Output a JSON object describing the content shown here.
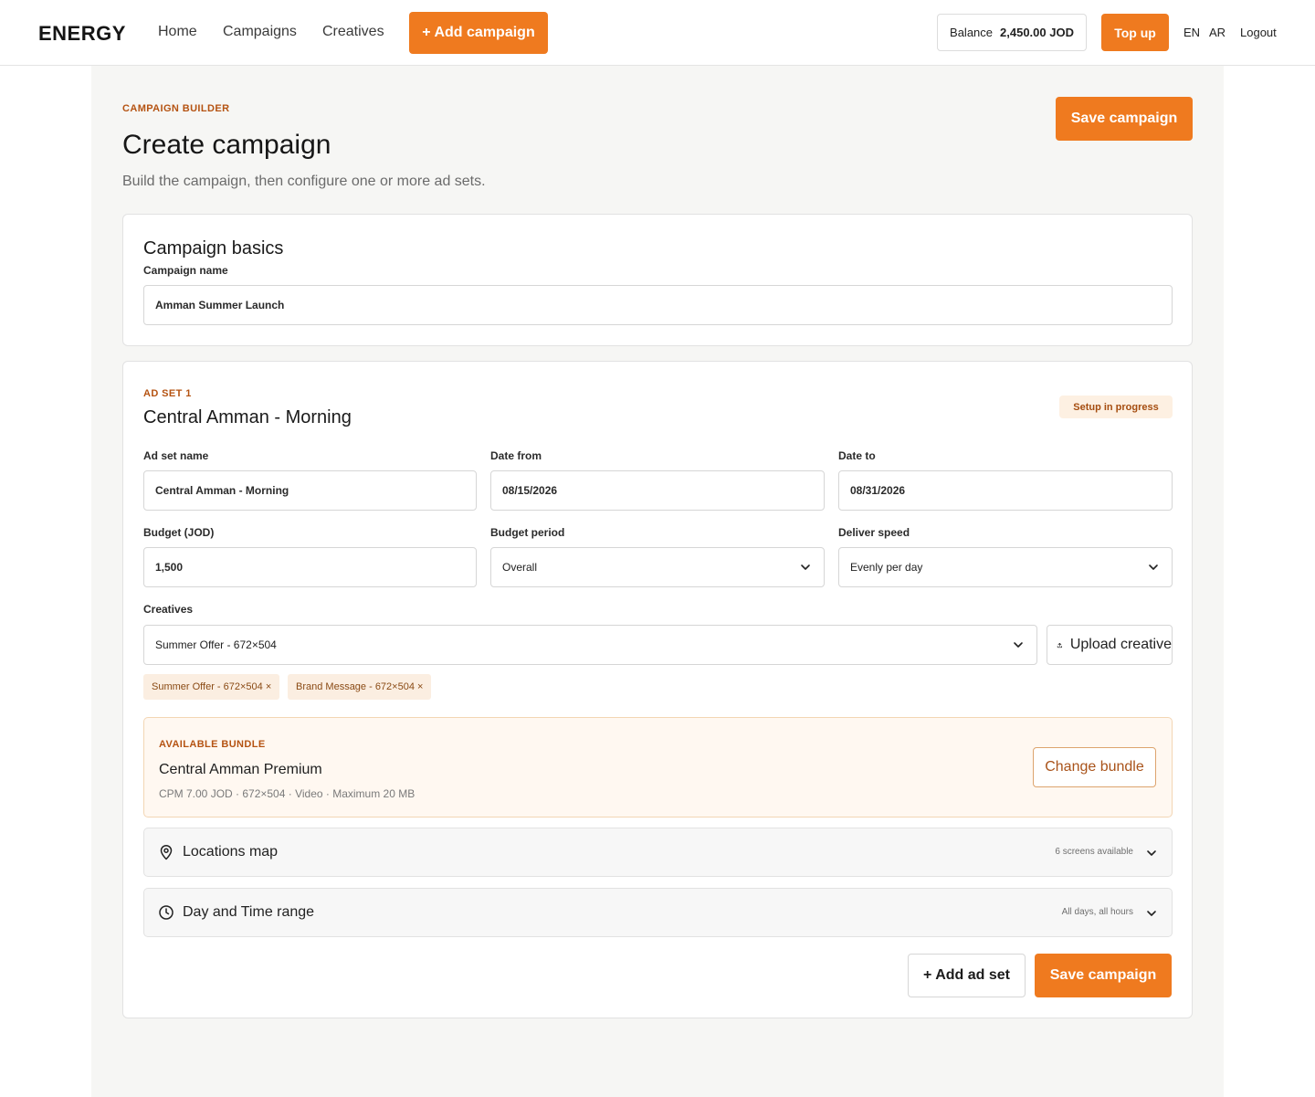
{
  "nav": {
    "brand": "ENERGY",
    "links": [
      "Home",
      "Campaigns",
      "Creatives"
    ],
    "add_campaign": "+ Add campaign",
    "balance_label": "Balance",
    "balance_value": "2,450.00 JOD",
    "top_up": "Top up",
    "lang_en": "EN",
    "lang_ar": "AR",
    "logout": "Logout"
  },
  "header": {
    "eyebrow": "CAMPAIGN BUILDER",
    "title": "Create campaign",
    "subtitle": "Build the campaign, then configure one or more ad sets.",
    "save": "Save campaign"
  },
  "basics": {
    "title": "Campaign basics",
    "name_label": "Campaign name",
    "name_value": "Amman Summer Launch"
  },
  "adset": {
    "eyebrow": "AD SET 1",
    "title": "Central Amman - Morning",
    "status": "Setup in progress",
    "fields": {
      "name_label": "Ad set name",
      "name_value": "Central Amman - Morning",
      "date_from_label": "Date from",
      "date_from_value": "08/15/2026",
      "date_to_label": "Date to",
      "date_to_value": "08/31/2026",
      "budget_label": "Budget (JOD)",
      "budget_value": "1,500",
      "period_label": "Budget period",
      "period_value": "Overall",
      "speed_label": "Deliver speed",
      "speed_value": "Evenly per day"
    },
    "creatives": {
      "label": "Creatives",
      "selected": "Summer Offer - 672×504",
      "upload": "Upload creative",
      "chips": [
        "Summer Offer - 672×504 ×",
        "Brand Message - 672×504 ×"
      ]
    },
    "bundle": {
      "eyebrow": "AVAILABLE BUNDLE",
      "name": "Central Amman Premium",
      "meta": "CPM 7.00 JOD · 672×504 · Video · Maximum 20 MB",
      "change": "Change bundle"
    },
    "locations": {
      "title": "Locations map",
      "meta": "6 screens available"
    },
    "daytime": {
      "title": "Day and Time range",
      "meta": "All days, all hours"
    },
    "add_adset": "+ Add ad set",
    "save": "Save campaign"
  },
  "colors": {
    "accent": "#ef7a1f",
    "accent_text": "#b55312",
    "page_bg": "#f6f6f4",
    "badge_bg": "#fdf0e2"
  },
  "icons": [
    "chevron-down-icon",
    "upload-icon",
    "location-pin-icon",
    "clock-icon"
  ]
}
